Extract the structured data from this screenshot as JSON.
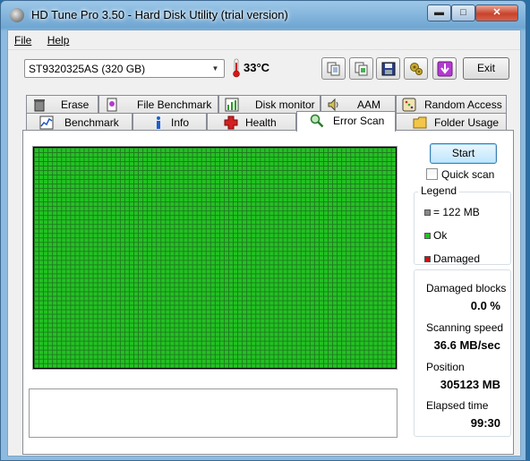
{
  "window": {
    "title": "HD Tune Pro 3.50 - Hard Disk Utility (trial version)",
    "controls": {
      "minimize": "▬",
      "maximize": "□",
      "close": "✕"
    }
  },
  "menu": {
    "file": "File",
    "help": "Help"
  },
  "toolbar": {
    "drive": "ST9320325AS (320 GB)",
    "temperature": "33°C",
    "exit_label": "Exit",
    "icons": [
      "copy-info-icon",
      "copy-screenshot-icon",
      "save-icon",
      "options-icon",
      "download-icon"
    ]
  },
  "tabs": {
    "row1": [
      {
        "label": "Erase",
        "icon": "trash-icon"
      },
      {
        "label": "File Benchmark",
        "icon": "file-benchmark-icon"
      },
      {
        "label": "Disk monitor",
        "icon": "chart-icon"
      },
      {
        "label": "AAM",
        "icon": "speaker-icon"
      },
      {
        "label": "Random Access",
        "icon": "dice-icon"
      }
    ],
    "row2": [
      {
        "label": "Benchmark",
        "icon": "benchmark-icon"
      },
      {
        "label": "Info",
        "icon": "info-icon"
      },
      {
        "label": "Health",
        "icon": "health-cross-icon"
      },
      {
        "label": "Error Scan",
        "icon": "magnifier-icon"
      },
      {
        "label": "Folder Usage",
        "icon": "folder-icon"
      }
    ],
    "active": "Error Scan"
  },
  "scan": {
    "start_label": "Start",
    "quick_scan_label": "Quick scan",
    "quick_scan_checked": false,
    "block_status": "all-ok"
  },
  "legend": {
    "title": "Legend",
    "block_size": "= 122 MB",
    "ok": "Ok",
    "damaged": "Damaged",
    "colors": {
      "block": "#888888",
      "ok": "#22c222",
      "damaged": "#cc1111"
    }
  },
  "stats": {
    "damaged_blocks_label": "Damaged blocks",
    "damaged_blocks_value": "0.0 %",
    "scanning_speed_label": "Scanning speed",
    "scanning_speed_value": "36.6 MB/sec",
    "position_label": "Position",
    "position_value": "305123 MB",
    "elapsed_label": "Elapsed time",
    "elapsed_value": "99:30"
  }
}
